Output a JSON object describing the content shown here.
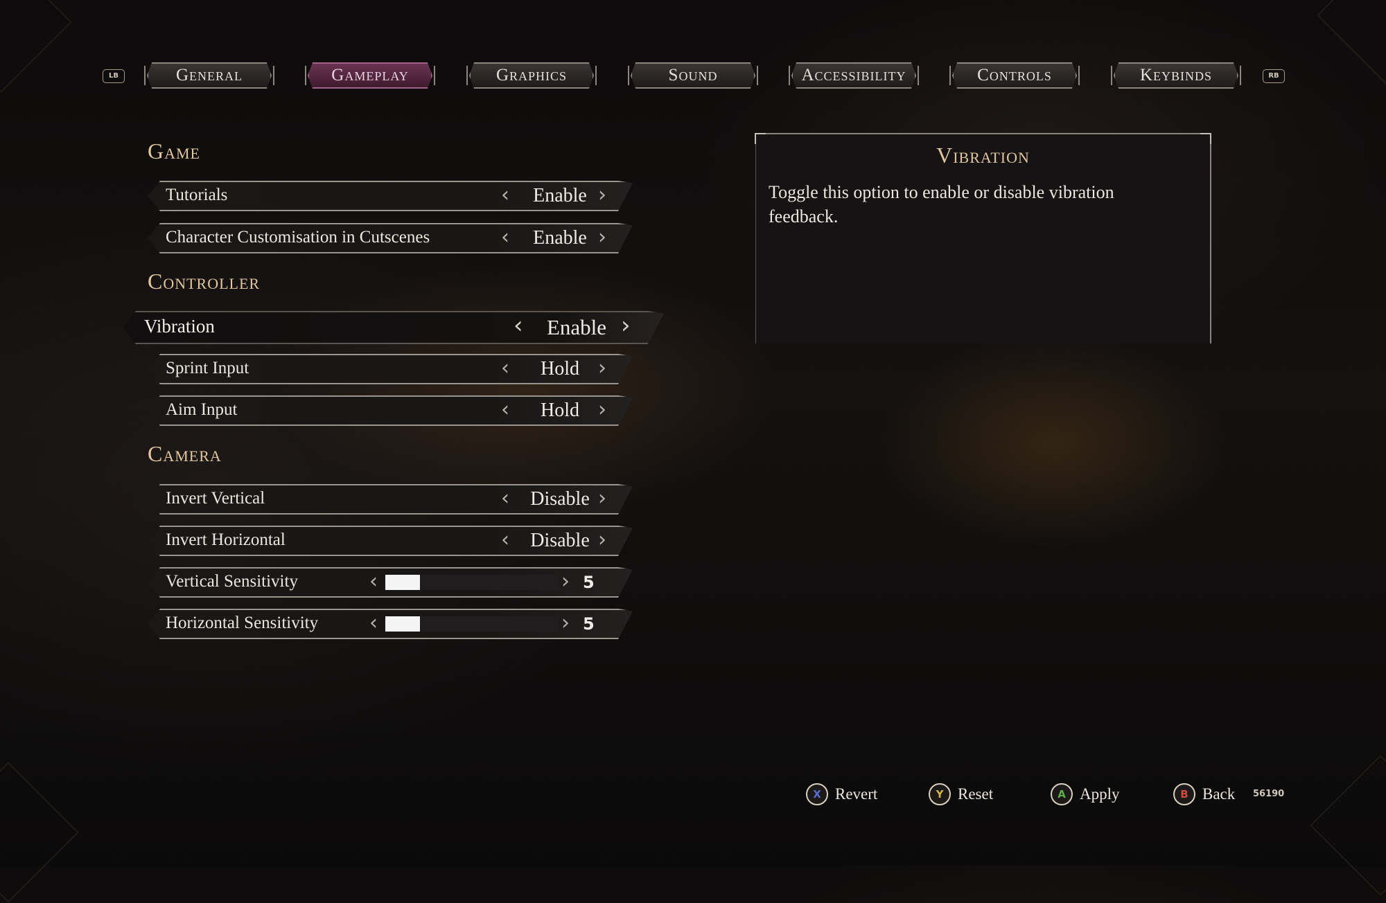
{
  "tabs": {
    "left_bumper": "LB",
    "right_bumper": "RB",
    "items": [
      {
        "label": "General"
      },
      {
        "label": "Gameplay"
      },
      {
        "label": "Graphics"
      },
      {
        "label": "Sound"
      },
      {
        "label": "Accessibility"
      },
      {
        "label": "Controls"
      },
      {
        "label": "Keybinds"
      }
    ],
    "active_index": 1
  },
  "sections": {
    "game": {
      "title": "Game",
      "rows": [
        {
          "label": "Tutorials",
          "value": "Enable"
        },
        {
          "label": "Character Customisation in Cutscenes",
          "value": "Enable"
        }
      ]
    },
    "controller": {
      "title": "Controller",
      "rows": [
        {
          "label": "Vibration",
          "value": "Enable",
          "selected": true
        },
        {
          "label": "Sprint Input",
          "value": "Hold"
        },
        {
          "label": "Aim Input",
          "value": "Hold"
        }
      ]
    },
    "camera": {
      "title": "Camera",
      "rows": [
        {
          "label": "Invert Vertical",
          "value": "Disable"
        },
        {
          "label": "Invert Horizontal",
          "value": "Disable"
        },
        {
          "label": "Vertical Sensitivity",
          "value": "5",
          "fill_fraction": 0.2
        },
        {
          "label": "Horizontal Sensitivity",
          "value": "5",
          "fill_fraction": 0.2
        }
      ]
    }
  },
  "description": {
    "title": "Vibration",
    "text": "Toggle this option to enable or disable vibration feedback."
  },
  "footer": {
    "revert": {
      "glyph": "X",
      "label": "Revert",
      "color": "#5b6cd6"
    },
    "reset": {
      "glyph": "Y",
      "label": "Reset",
      "color": "#d9b44a"
    },
    "apply": {
      "glyph": "A",
      "label": "Apply",
      "color": "#5fae4a"
    },
    "back": {
      "glyph": "B",
      "label": "Back",
      "color": "#d04b3c"
    },
    "build_id": "56190"
  },
  "colors": {
    "accent_gold": "#e2c69d",
    "active_tab": "#6b3350"
  }
}
